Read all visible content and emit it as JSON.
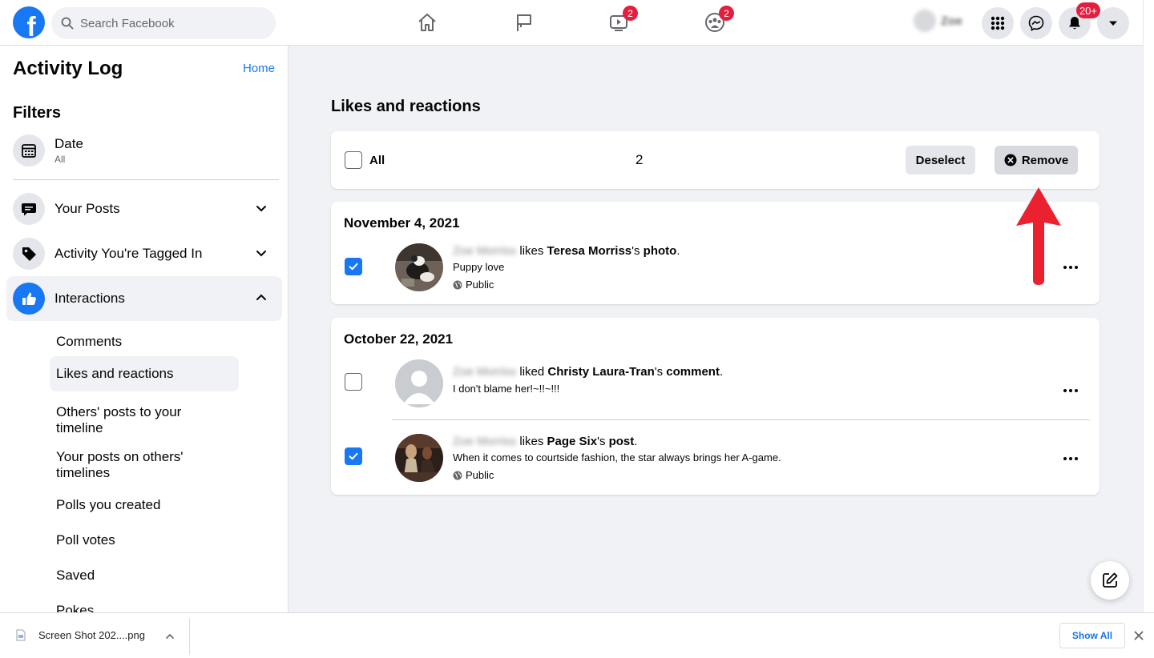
{
  "topbar": {
    "logo": "f",
    "search_placeholder": "Search Facebook",
    "watch_badge": "2",
    "groups_badge": "2",
    "profile_name": "Zoe",
    "notifications_badge": "20+"
  },
  "sidebar": {
    "title": "Activity Log",
    "home_link": "Home",
    "filters_heading": "Filters",
    "date_filter": {
      "label": "Date",
      "value": "All"
    },
    "categories": [
      {
        "label": "Your Posts"
      },
      {
        "label": "Activity You're Tagged In"
      },
      {
        "label": "Interactions"
      }
    ],
    "sub_items": [
      "Comments",
      "Likes and reactions",
      "Others' posts to your timeline",
      "Your posts on others' timelines",
      "Polls you created",
      "Poll votes",
      "Saved",
      "Pokes"
    ]
  },
  "main": {
    "section_title": "Likes and reactions",
    "selection_bar": {
      "all_label": "All",
      "selected_count": "2",
      "deselect_label": "Deselect",
      "remove_label": "Remove"
    },
    "groups": [
      {
        "date": "November 4, 2021",
        "entries": [
          {
            "actor": "Zoe Morriss",
            "verb": " likes ",
            "target": "Teresa Morriss",
            "possessive": "'s ",
            "object": "photo",
            "end": ".",
            "snippet": "Puppy love",
            "audience": "Public",
            "checked": true
          }
        ]
      },
      {
        "date": "October 22, 2021",
        "entries": [
          {
            "actor": "Zoe Morriss",
            "verb": " liked ",
            "target": "Christy Laura-Tran",
            "possessive": "'s ",
            "object": "comment",
            "end": ".",
            "snippet": "I don't blame her!~!!~!!!",
            "checked": false
          },
          {
            "actor": "Zoe Morriss",
            "verb": " likes ",
            "target": "Page Six",
            "possessive": "'s ",
            "object": "post",
            "end": ".",
            "snippet": "When it comes to courtside fashion, the star always brings her A-game.",
            "audience": "Public",
            "checked": true
          }
        ]
      }
    ]
  },
  "download_bar": {
    "file_name": "Screen Shot 202....png",
    "show_all_label": "Show All"
  },
  "colors": {
    "brand_blue": "#1877f2",
    "badge_red": "#e41e3f",
    "annotation_arrow_red": "#ec2130"
  }
}
